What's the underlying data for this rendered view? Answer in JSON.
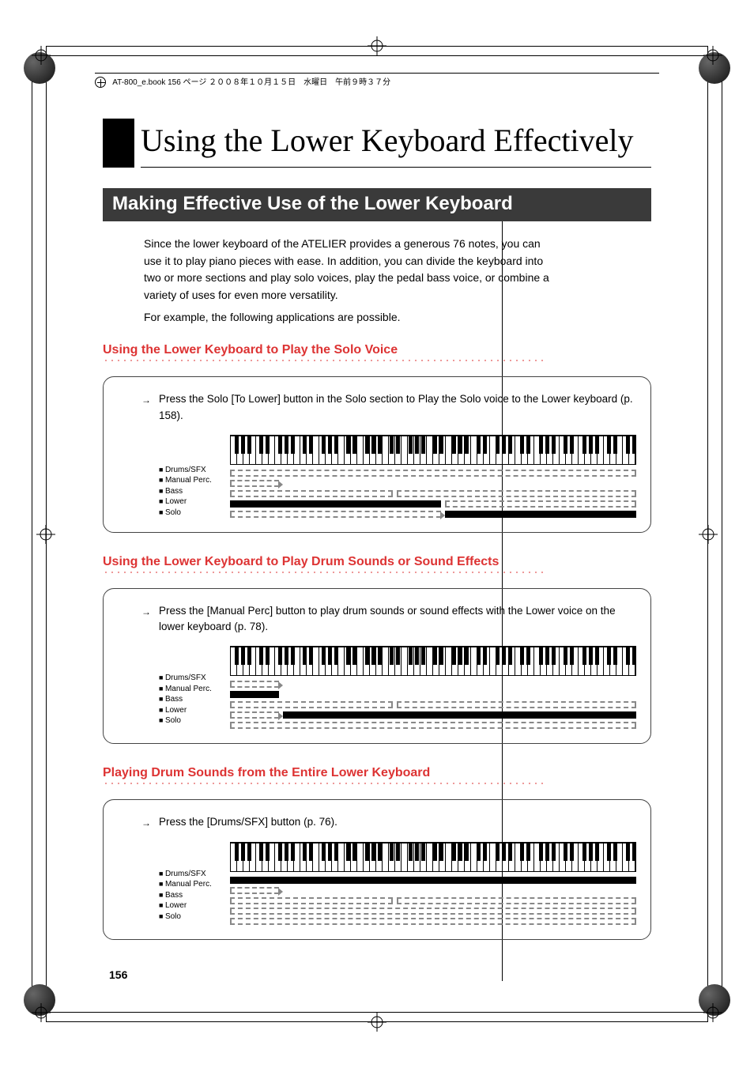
{
  "header_text": "AT-800_e.book  156 ページ  ２００８年１０月１５日　水曜日　午前９時３７分",
  "page_title": "Using the Lower Keyboard Effectively",
  "section_title": "Making Effective Use of the Lower Keyboard",
  "intro_p1": "Since the lower keyboard of the ATELIER provides a generous 76 notes, you can use it to play piano pieces with ease. In addition, you can divide the keyboard into two or more sections and play solo voices, play the pedal bass voice, or combine a variety of uses for even more versatility.",
  "intro_p2": "For example, the following applications are possible.",
  "sub1": {
    "title": "Using the Lower Keyboard to Play the Solo Voice",
    "step": "Press the Solo [To Lower] button in the Solo section to Play the Solo voice to the Lower keyboard (p. 158)."
  },
  "sub2": {
    "title": "Using the Lower Keyboard to Play Drum Sounds or Sound Effects",
    "step": "Press the [Manual Perc] button to play drum sounds or sound effects with the Lower voice on the lower keyboard (p. 78)."
  },
  "sub3": {
    "title": "Playing Drum Sounds from the Entire Lower Keyboard",
    "step": "Press the [Drums/SFX] button (p. 76)."
  },
  "labels": {
    "drums": "Drums/SFX",
    "manual": "Manual Perc.",
    "bass": "Bass",
    "lower": "Lower",
    "solo": "Solo"
  },
  "page_number": "156"
}
